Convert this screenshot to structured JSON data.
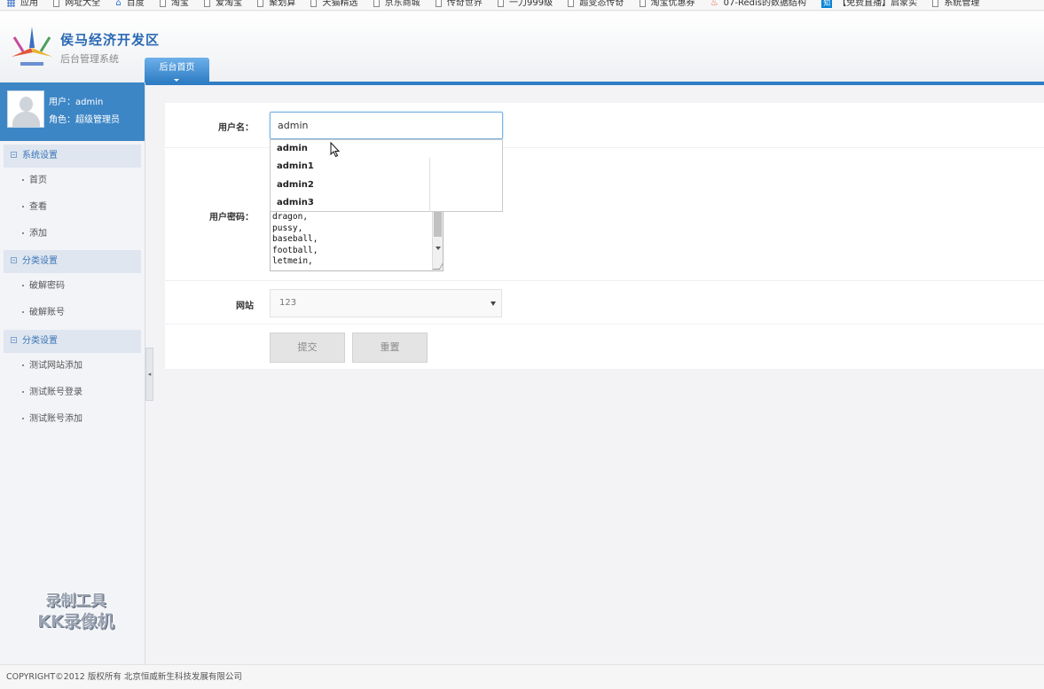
{
  "bookmarks": [
    {
      "label": "应用",
      "icon": "apps-icon"
    },
    {
      "label": "网址大全",
      "icon": "page-icon"
    },
    {
      "label": "百度",
      "icon": "home-icon"
    },
    {
      "label": "淘宝",
      "icon": "page-icon"
    },
    {
      "label": "爱淘宝",
      "icon": "page-icon"
    },
    {
      "label": "聚划算",
      "icon": "page-icon"
    },
    {
      "label": "天猫精选",
      "icon": "page-icon"
    },
    {
      "label": "京东商城",
      "icon": "page-icon"
    },
    {
      "label": "传奇世界",
      "icon": "page-icon"
    },
    {
      "label": "一刀999级",
      "icon": "page-icon"
    },
    {
      "label": "超变态传奇",
      "icon": "page-icon"
    },
    {
      "label": "淘宝优惠券",
      "icon": "page-icon"
    },
    {
      "label": "07-Redis的数据结构",
      "icon": "fire-icon"
    },
    {
      "label": "【免费直播】启蒙实",
      "icon": "zhihu-icon"
    },
    {
      "label": "系统管理",
      "icon": "page-icon"
    }
  ],
  "header": {
    "title": "侯马经济开发区",
    "subtitle": "后台管理系统",
    "tab_home": "后台首页"
  },
  "user": {
    "name_line": "用户：admin",
    "role_line": "角色：超级管理员"
  },
  "sidebar": {
    "sections": [
      {
        "title": "系统设置",
        "items": [
          "首页",
          "查看",
          "添加"
        ]
      },
      {
        "title": "分类设置",
        "items": [
          "破解密码",
          "破解账号"
        ]
      },
      {
        "title": "分类设置",
        "items": [
          "测试网站添加",
          "测试账号登录",
          "测试账号添加"
        ]
      }
    ]
  },
  "watermark": {
    "line1": "录制工具",
    "line2": "KK录像机"
  },
  "form": {
    "username_label": "用户名：",
    "username_value": "admin",
    "autocomplete": [
      "admin",
      "admin1",
      "admin2",
      "admin3"
    ],
    "password_label": "用户密码：",
    "password_lines": [
      "dragon,",
      "pussy,",
      "baseball,",
      "football,",
      "letmein,"
    ],
    "site_label": "网站",
    "site_value": "123",
    "submit_label": "提交",
    "reset_label": "重置"
  },
  "footer": {
    "text": "COPYRIGHT©2012 版权所有 北京恒威新生科技发展有限公司"
  }
}
